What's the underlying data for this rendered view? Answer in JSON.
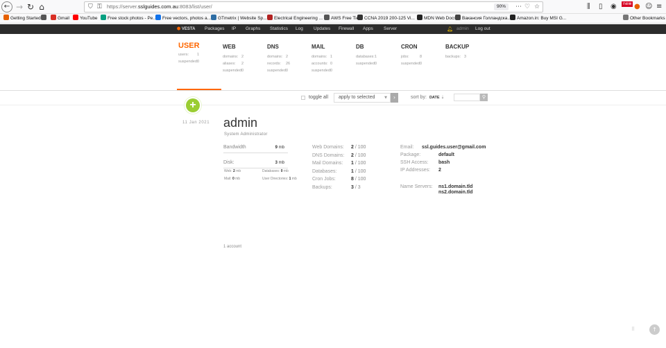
{
  "browser": {
    "url_prefix": "https://server.",
    "url_host": "sslguides.com.au",
    "url_suffix": ":8083/list/user/",
    "zoom": "90%",
    "icons": [
      "back-icon",
      "forward-icon",
      "reload-icon",
      "home-icon",
      "shield-icon",
      "lock-icon",
      "page-actions-icon",
      "pocket-icon",
      "star-icon",
      "library-icon",
      "sidebar-icon",
      "reader-icon",
      "account-icon",
      "extension-new-icon",
      "extension-icon",
      "menu-icon"
    ]
  },
  "bookmarks": [
    {
      "label": "Getting Started",
      "color": "#e66000"
    },
    {
      "label": "",
      "color": "#555555"
    },
    {
      "label": "Gmail",
      "color": "#d93025"
    },
    {
      "label": "YouTube",
      "color": "#ff0000"
    },
    {
      "label": "Free stock photos - Pe...",
      "color": "#05a081"
    },
    {
      "label": "Free vectors, photos a...",
      "color": "#1273eb"
    },
    {
      "label": "GTmetrix | Website Sp...",
      "color": "#2e6da4"
    },
    {
      "label": "Electrical Engineering ...",
      "color": "#b22222"
    },
    {
      "label": "AWS Free Tier",
      "color": "#555555"
    },
    {
      "label": "CCNA 2019 200-125 Vi...",
      "color": "#333333"
    },
    {
      "label": "MDN Web Docs",
      "color": "#222222"
    },
    {
      "label": "Вакансия Голландска...",
      "color": "#444444"
    },
    {
      "label": "Amazon.in: Buy MSI G...",
      "color": "#222222"
    },
    {
      "label": "Other Bookmarks",
      "color": "#777777"
    }
  ],
  "topnav": {
    "logo": "VESTA",
    "items": [
      "Packages",
      "IP",
      "Graphs",
      "Statistics",
      "Log",
      "Updates",
      "Firewall",
      "Apps",
      "Server"
    ],
    "user": "admin",
    "logout": "Log out"
  },
  "stats": [
    {
      "title": "USER",
      "active": true,
      "lines": [
        [
          "users:",
          "1"
        ],
        [
          "suspended:",
          "0"
        ]
      ]
    },
    {
      "title": "WEB",
      "active": false,
      "lines": [
        [
          "domains:",
          "2"
        ],
        [
          "aliases:",
          "2"
        ],
        [
          "suspended:",
          "0"
        ]
      ]
    },
    {
      "title": "DNS",
      "active": false,
      "lines": [
        [
          "domains:",
          "2"
        ],
        [
          "records:",
          "26"
        ],
        [
          "suspended:",
          "0"
        ]
      ]
    },
    {
      "title": "MAIL",
      "active": false,
      "lines": [
        [
          "domains:",
          "1"
        ],
        [
          "accounts:",
          "0"
        ],
        [
          "suspended:",
          "0"
        ]
      ]
    },
    {
      "title": "DB",
      "active": false,
      "lines": [
        [
          "databases:",
          "1"
        ],
        [
          "suspended:",
          "0"
        ]
      ]
    },
    {
      "title": "CRON",
      "active": false,
      "lines": [
        [
          "jobs:",
          "8"
        ],
        [
          "suspended:",
          "0"
        ]
      ]
    },
    {
      "title": "BACKUP",
      "active": false,
      "lines": [
        [
          "backups:",
          "3"
        ]
      ]
    }
  ],
  "toolbar": {
    "toggle_all": "toggle all",
    "apply_to_selected": "apply to selected",
    "sort_by": "sort by:",
    "sort_value": "DATE",
    "sort_arrow": "⇣"
  },
  "user_row": {
    "date": "11  Jan  2021",
    "name": "admin",
    "role": "System Administrator",
    "bandwidth": {
      "label": "Bandwidth",
      "value": "9",
      "unit": "mb"
    },
    "disk": {
      "label": "Disk:",
      "value": "3",
      "unit": "mb"
    },
    "disk_sub": [
      {
        "label": "Web:",
        "value": "2",
        "unit": "mb"
      },
      {
        "label": "Databases:",
        "value": "0",
        "unit": "mb"
      },
      {
        "label": "Mail:",
        "value": "0",
        "unit": "mb"
      },
      {
        "label": "User Directories:",
        "value": "1",
        "unit": "mb"
      }
    ],
    "limits": [
      {
        "label": "Web Domains:",
        "used": "2",
        "max": " / 100"
      },
      {
        "label": "DNS Domains:",
        "used": "2",
        "max": " / 100"
      },
      {
        "label": "Mail Domains:",
        "used": "1",
        "max": " / 100"
      },
      {
        "label": "Databases:",
        "used": "1",
        "max": " / 100"
      },
      {
        "label": "Cron Jobs:",
        "used": "8",
        "max": " / 100"
      },
      {
        "label": "Backups:",
        "used": "3",
        "max": " / 3"
      }
    ],
    "info": [
      {
        "label": "Email:",
        "value": "ssl.guides.user@gmail.com"
      },
      {
        "label": "Package:",
        "value": "default"
      },
      {
        "label": "SSH Access:",
        "value": "bash"
      },
      {
        "label": "IP Addresses:",
        "value": "2"
      }
    ],
    "name_servers_label": "Name Servers:",
    "name_servers": [
      "ns1.domain.tld",
      "ns2.domain.tld"
    ]
  },
  "footer": {
    "count": "1 account"
  }
}
